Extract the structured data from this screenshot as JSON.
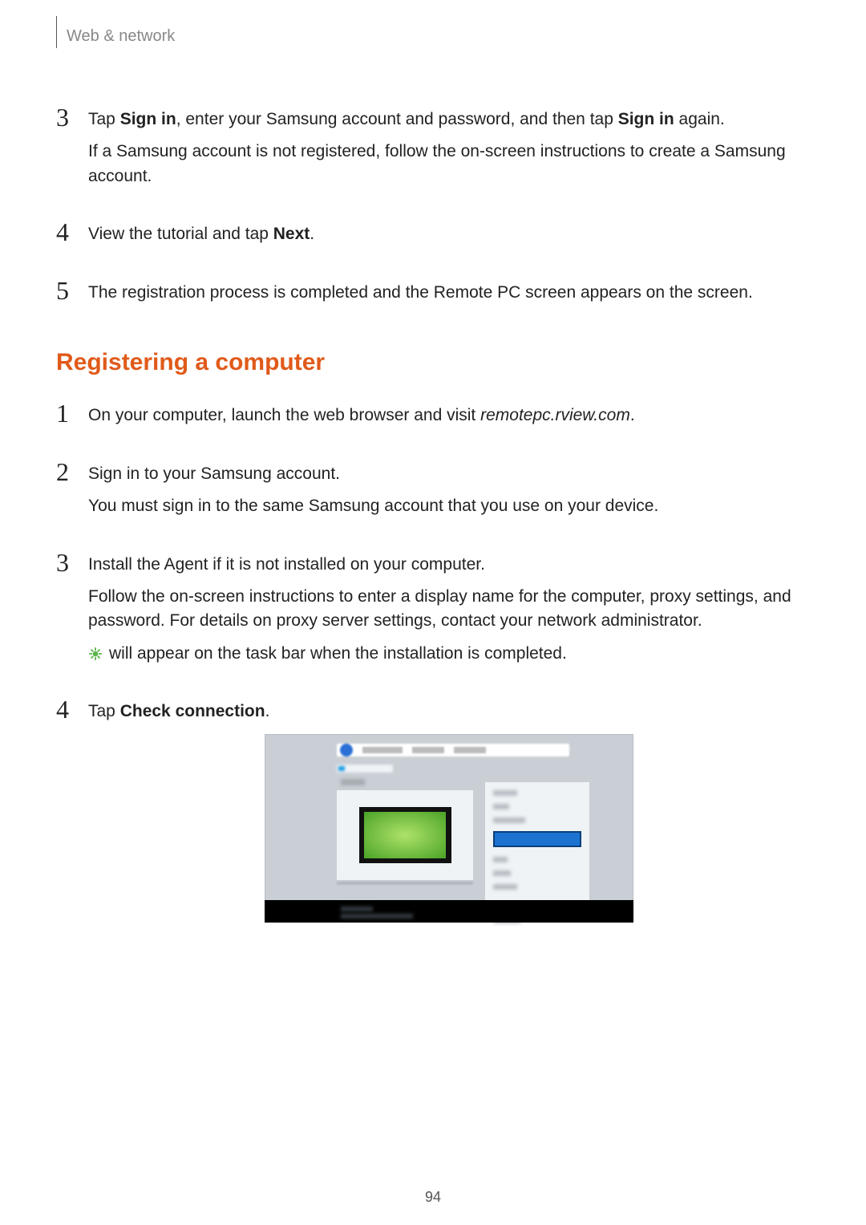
{
  "header": {
    "breadcrumb": "Web & network"
  },
  "steps_a": [
    {
      "num": "3",
      "html_parts": [
        {
          "type": "text",
          "value": "Tap "
        },
        {
          "type": "bold",
          "value": "Sign in"
        },
        {
          "type": "text",
          "value": ", enter your Samsung account and password, and then tap "
        },
        {
          "type": "bold",
          "value": "Sign in"
        },
        {
          "type": "text",
          "value": " again."
        }
      ],
      "followup": "If a Samsung account is not registered, follow the on-screen instructions to create a Samsung account."
    },
    {
      "num": "4",
      "html_parts": [
        {
          "type": "text",
          "value": "View the tutorial and tap "
        },
        {
          "type": "bold",
          "value": "Next"
        },
        {
          "type": "text",
          "value": "."
        }
      ]
    },
    {
      "num": "5",
      "html_parts": [
        {
          "type": "text",
          "value": "The registration process is completed and the Remote PC screen appears on the screen."
        }
      ]
    }
  ],
  "section_heading": "Registering a computer",
  "steps_b": [
    {
      "num": "1",
      "html_parts": [
        {
          "type": "text",
          "value": "On your computer, launch the web browser and visit "
        },
        {
          "type": "italic",
          "value": "remotepc.rview.com"
        },
        {
          "type": "text",
          "value": "."
        }
      ]
    },
    {
      "num": "2",
      "html_parts": [
        {
          "type": "text",
          "value": "Sign in to your Samsung account."
        }
      ],
      "followup": "You must sign in to the same Samsung account that you use on your device."
    },
    {
      "num": "3",
      "html_parts": [
        {
          "type": "text",
          "value": "Install the Agent if it is not installed on your computer."
        }
      ],
      "followup": "Follow the on-screen instructions to enter a display name for the computer, proxy settings, and password. For details on proxy server settings, contact your network administrator.",
      "icon_line": " will appear on the task bar when the installation is completed."
    },
    {
      "num": "4",
      "html_parts": [
        {
          "type": "text",
          "value": "Tap "
        },
        {
          "type": "bold",
          "value": "Check connection"
        },
        {
          "type": "text",
          "value": "."
        }
      ],
      "has_screenshot": true
    }
  ],
  "icon_name": "remote-pc-tray-icon",
  "page_number": "94"
}
